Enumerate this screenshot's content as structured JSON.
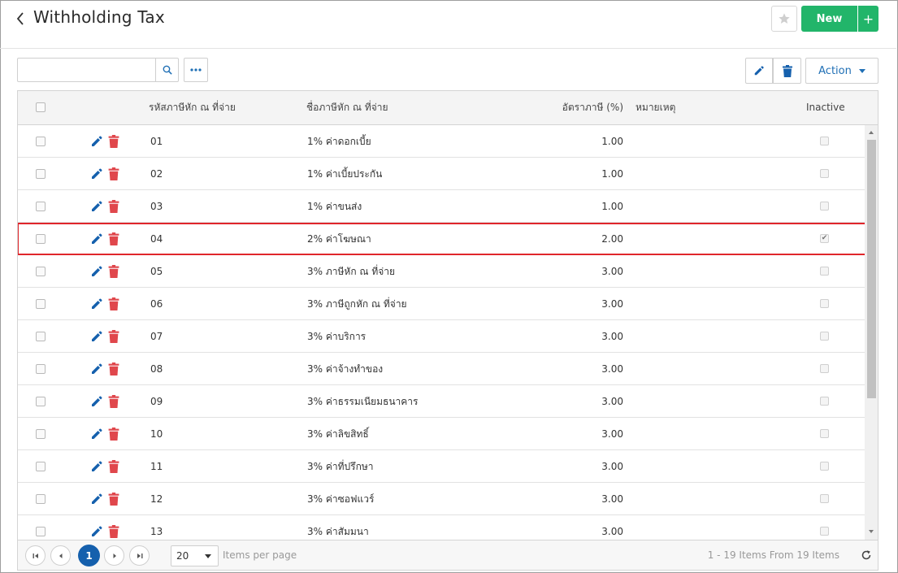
{
  "header": {
    "title": "Withholding Tax",
    "new_label": "New",
    "new_plus": "+"
  },
  "toolbar": {
    "search_value": "",
    "action_label": "Action"
  },
  "grid": {
    "columns": {
      "code": "รหัสภาษีหัก ณ ที่จ่าย",
      "name": "ชื่อภาษีหัก ณ ที่จ่าย",
      "rate": "อัตราภาษี (%)",
      "remark": "หมายเหตุ",
      "inactive": "Inactive"
    },
    "rows": [
      {
        "code": "01",
        "name": "1% ค่าดอกเบี้ย",
        "rate": "1.00",
        "inactive": false
      },
      {
        "code": "02",
        "name": "1% ค่าเบี้ยประกัน",
        "rate": "1.00",
        "inactive": false
      },
      {
        "code": "03",
        "name": "1% ค่าขนส่ง",
        "rate": "1.00",
        "inactive": false
      },
      {
        "code": "04",
        "name": "2% ค่าโฆษณา",
        "rate": "2.00",
        "inactive": true
      },
      {
        "code": "05",
        "name": "3% ภาษีหัก ณ ที่จ่าย",
        "rate": "3.00",
        "inactive": false
      },
      {
        "code": "06",
        "name": "3% ภาษีถูกหัก ณ ที่จ่าย",
        "rate": "3.00",
        "inactive": false
      },
      {
        "code": "07",
        "name": "3% ค่าบริการ",
        "rate": "3.00",
        "inactive": false
      },
      {
        "code": "08",
        "name": "3% ค่าจ้างทำของ",
        "rate": "3.00",
        "inactive": false
      },
      {
        "code": "09",
        "name": "3% ค่าธรรมเนียมธนาคาร",
        "rate": "3.00",
        "inactive": false
      },
      {
        "code": "10",
        "name": "3% ค่าลิขสิทธิ์",
        "rate": "3.00",
        "inactive": false
      },
      {
        "code": "11",
        "name": "3% ค่าที่ปรึกษา",
        "rate": "3.00",
        "inactive": false
      },
      {
        "code": "12",
        "name": "3% ค่าซอฟแวร์",
        "rate": "3.00",
        "inactive": false
      },
      {
        "code": "13",
        "name": "3% ค่าสัมมนา",
        "rate": "3.00",
        "inactive": false
      }
    ],
    "highlighted_row": 3
  },
  "pager": {
    "current_page": "1",
    "page_size": "20",
    "items_per_page_label": "Items per page",
    "info": "1 - 19 Items From 19 Items"
  },
  "colors": {
    "primary_blue": "#1560ad",
    "new_green": "#22b56a",
    "delete_red": "#e0474c",
    "highlight_red": "#e0262b"
  },
  "icons": {
    "back": "chevron-left-icon",
    "favorite": "star-icon",
    "search": "search-icon",
    "more": "ellipsis-icon",
    "edit": "pencil-icon",
    "delete": "trash-icon",
    "refresh": "refresh-icon"
  }
}
